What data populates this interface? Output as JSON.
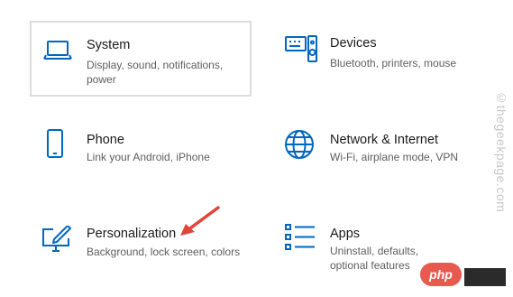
{
  "accent_color": "#0067c0",
  "tiles": [
    {
      "id": "system",
      "title": "System",
      "desc": "Display, sound, notifications, power",
      "icon": "laptop-icon",
      "selected": true
    },
    {
      "id": "devices",
      "title": "Devices",
      "desc": "Bluetooth, printers, mouse",
      "icon": "keyboard-speaker-icon"
    },
    {
      "id": "phone",
      "title": "Phone",
      "desc": "Link your Android, iPhone",
      "icon": "phone-icon"
    },
    {
      "id": "network",
      "title": "Network & Internet",
      "desc": "Wi-Fi, airplane mode, VPN",
      "icon": "globe-icon"
    },
    {
      "id": "personalization",
      "title": "Personalization",
      "desc": "Background, lock screen, colors",
      "icon": "monitor-pen-icon"
    },
    {
      "id": "apps",
      "title": "Apps",
      "desc": "Uninstall, defaults, optional features",
      "icon": "app-list-icon"
    }
  ],
  "watermark": "©thegeekpage.com",
  "badge": "php",
  "annotation_arrow_color": "#e0443a"
}
